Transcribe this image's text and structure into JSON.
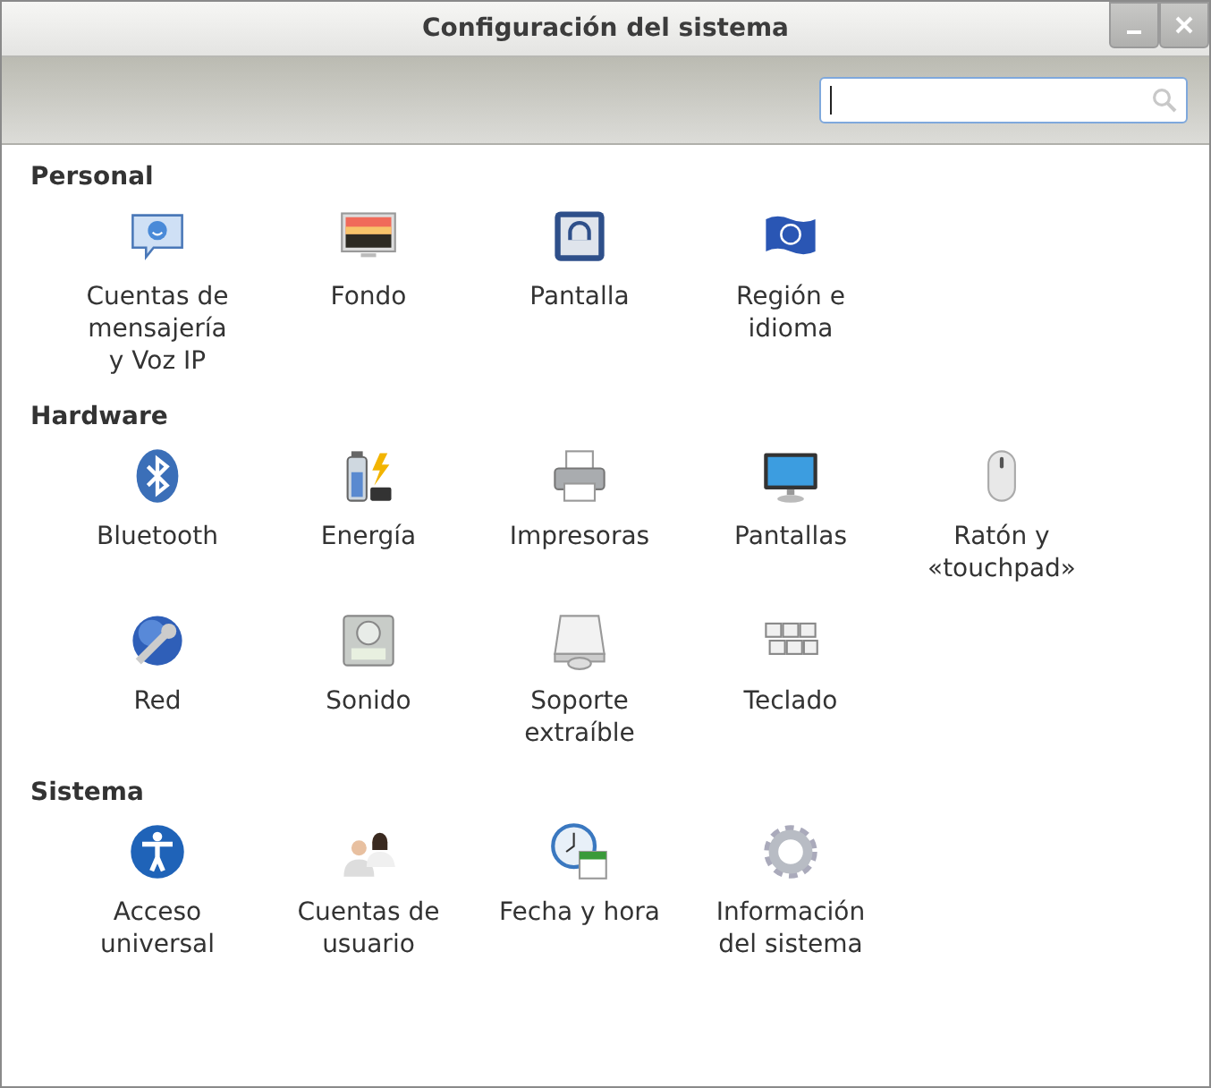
{
  "window": {
    "title": "Configuración del sistema"
  },
  "search": {
    "focused": true
  },
  "sections": [
    {
      "title": "Personal",
      "items": [
        {
          "kind": "chat",
          "lines": [
            "Cuentas de",
            "mensajería",
            "y Voz IP"
          ]
        },
        {
          "kind": "wallpaper",
          "lines": [
            "Fondo"
          ]
        },
        {
          "kind": "lock",
          "lines": [
            "Pantalla"
          ]
        },
        {
          "kind": "flag",
          "lines": [
            "Región e",
            "idioma"
          ]
        }
      ]
    },
    {
      "title": "Hardware",
      "items": [
        {
          "kind": "bluetooth",
          "lines": [
            "Bluetooth"
          ]
        },
        {
          "kind": "battery",
          "lines": [
            "Energía"
          ]
        },
        {
          "kind": "printer",
          "lines": [
            "Impresoras"
          ]
        },
        {
          "kind": "monitor",
          "lines": [
            "Pantallas"
          ]
        },
        {
          "kind": "mouse",
          "lines": [
            "Ratón y",
            "«touchpad»"
          ]
        },
        {
          "kind": "network",
          "lines": [
            "Red"
          ]
        },
        {
          "kind": "sound",
          "lines": [
            "Sonido"
          ]
        },
        {
          "kind": "drive",
          "lines": [
            "Soporte",
            "extraíble"
          ]
        },
        {
          "kind": "keyboard",
          "lines": [
            "Teclado"
          ]
        }
      ]
    },
    {
      "title": "Sistema",
      "items": [
        {
          "kind": "accessibility",
          "lines": [
            "Acceso",
            "universal"
          ]
        },
        {
          "kind": "users",
          "lines": [
            "Cuentas de",
            "usuario"
          ]
        },
        {
          "kind": "clock",
          "lines": [
            "Fecha y hora"
          ]
        },
        {
          "kind": "gear",
          "lines": [
            "Información",
            "del sistema"
          ]
        }
      ]
    }
  ]
}
